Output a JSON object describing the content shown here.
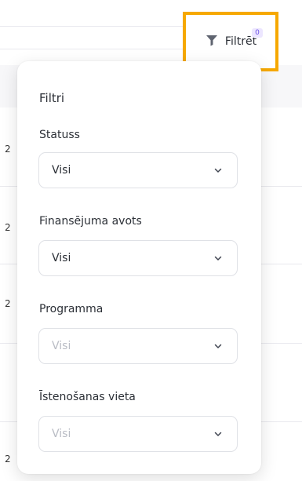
{
  "filter_button": {
    "label": "Filtrēt",
    "badge": "0",
    "highlight_color": "#f6a800"
  },
  "panel": {
    "title": "Filtri",
    "fields": [
      {
        "label": "Statuss",
        "value": "Visi",
        "disabled": false
      },
      {
        "label": "Finansējuma avots",
        "value": "Visi",
        "disabled": false
      },
      {
        "label": "Programma",
        "value": "Visi",
        "disabled": true
      },
      {
        "label": "Īstenošanas vieta",
        "value": "Visi",
        "disabled": true
      }
    ]
  },
  "background_rows": [
    "2",
    "2",
    "2",
    "2"
  ]
}
